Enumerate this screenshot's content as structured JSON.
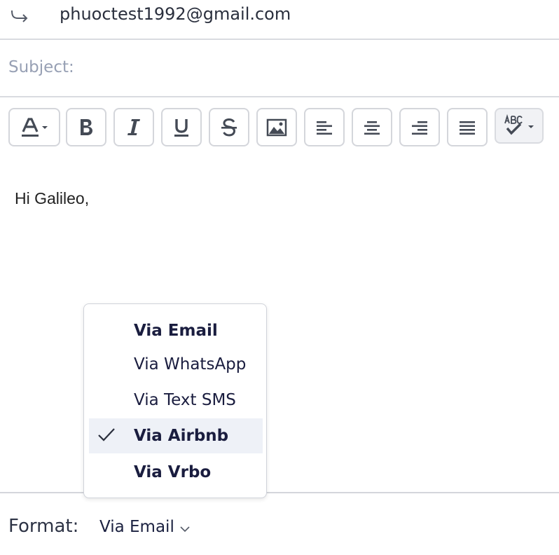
{
  "to": {
    "email": "phuoctest1992@gmail.com"
  },
  "subject": {
    "placeholder": "Subject:",
    "value": ""
  },
  "toolbar": {
    "buttons": [
      {
        "name": "text-color",
        "icon": "text-color-icon"
      },
      {
        "name": "bold",
        "icon": "bold-icon"
      },
      {
        "name": "italic",
        "icon": "italic-icon"
      },
      {
        "name": "underline",
        "icon": "underline-icon"
      },
      {
        "name": "strikethrough",
        "icon": "strikethrough-icon"
      },
      {
        "name": "insert-image",
        "icon": "image-icon"
      },
      {
        "name": "align-left",
        "icon": "align-left-icon"
      },
      {
        "name": "align-center",
        "icon": "align-center-icon"
      },
      {
        "name": "align-right",
        "icon": "align-right-icon"
      },
      {
        "name": "justify",
        "icon": "align-justify-icon"
      },
      {
        "name": "spellcheck",
        "icon": "spellcheck-icon"
      }
    ]
  },
  "message": {
    "body": "Hi Galileo,"
  },
  "format": {
    "label": "Format:",
    "selected": "Via Email",
    "options": [
      {
        "label": "Via Email",
        "checked": false,
        "bold": true
      },
      {
        "label": "Via WhatsApp",
        "checked": false,
        "bold": false
      },
      {
        "label": "Via Text SMS",
        "checked": false,
        "bold": false
      },
      {
        "label": "Via Airbnb",
        "checked": true,
        "bold": true
      },
      {
        "label": "Via Vrbo",
        "checked": false,
        "bold": true
      }
    ]
  },
  "colors": {
    "text": "#1a1d3f",
    "border": "#d4d6db",
    "placeholder": "#97a0b4",
    "selected_bg": "#eef1f7"
  }
}
